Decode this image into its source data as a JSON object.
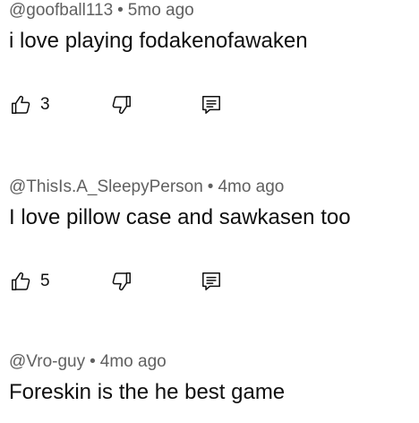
{
  "comments": [
    {
      "author": "@goofball113",
      "separator": "•",
      "time": "5mo ago",
      "text": "i love playing fodakenofawaken",
      "like_count": "3",
      "icons": {
        "like": "thumbs-up-icon",
        "dislike": "thumbs-down-icon",
        "reply": "reply-comment-icon"
      }
    },
    {
      "author": "@ThisIs.A_SleepyPerson",
      "separator": "•",
      "time": "4mo ago",
      "text": "I love pillow case and sawkasen too",
      "like_count": "5",
      "icons": {
        "like": "thumbs-up-icon",
        "dislike": "thumbs-down-icon",
        "reply": "reply-comment-icon"
      }
    },
    {
      "author": "@Vro-guy",
      "separator": "•",
      "time": "4mo ago",
      "text": "Foreskin is the he best game"
    }
  ]
}
